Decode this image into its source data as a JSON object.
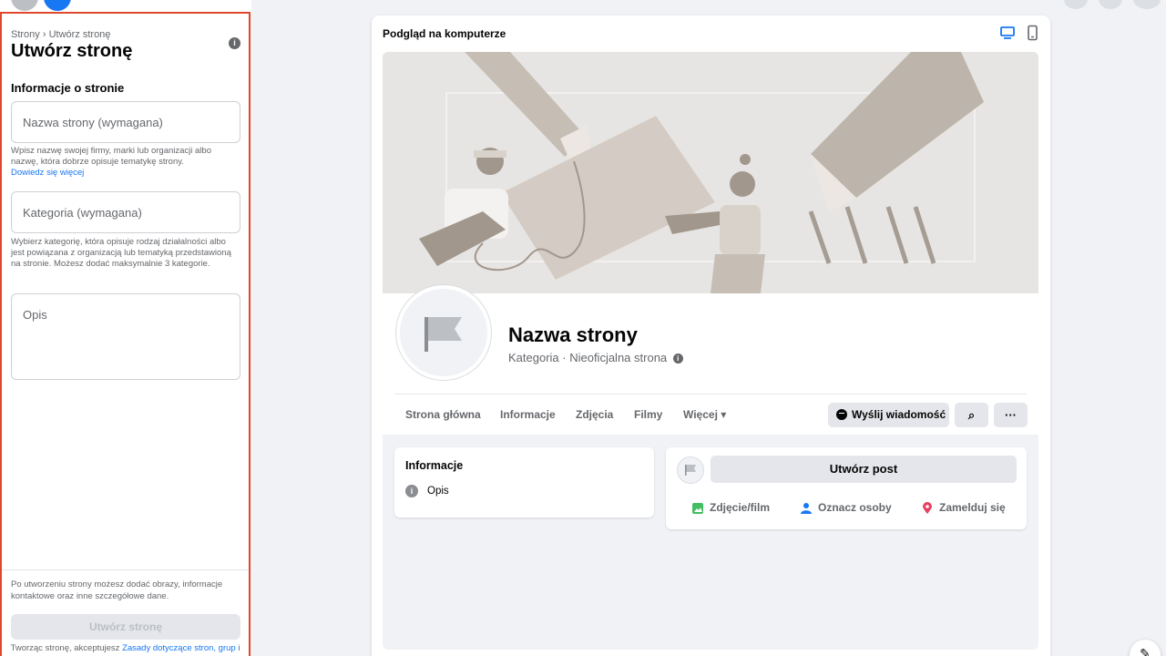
{
  "left_panel": {
    "breadcrumb": "Strony › Utwórz stronę",
    "title": "Utwórz stronę",
    "info_glyph": "i",
    "section_title": "Informacje o stronie",
    "name_field": {
      "placeholder": "Nazwa strony (wymagana)"
    },
    "name_help": "Wpisz nazwę swojej firmy, marki lub organizacji albo nazwę, która dobrze opisuje tematykę strony.",
    "name_help_link": "Dowiedz się więcej",
    "category_field": {
      "placeholder": "Kategoria (wymagana)"
    },
    "category_help": "Wybierz kategorię, która opisuje rodzaj działalności albo jest powiązana z organizacją lub tematyką przedstawioną na stronie. Możesz dodać maksymalnie 3 kategorie.",
    "description_field": {
      "placeholder": "Opis"
    },
    "footer_text": "Po utworzeniu strony możesz dodać obrazy, informacje kontaktowe oraz inne szczegółowe dane.",
    "create_button": "Utwórz stronę",
    "terms_text": "Tworząc stronę, akceptujesz",
    "terms_link": "Zasady dotyczące stron, grup i wydarzeń"
  },
  "preview": {
    "title": "Podgląd na komputerze",
    "icons": [
      "desktop-icon",
      "mobile-icon"
    ],
    "page_name": "Nazwa strony",
    "page_subtitle": "Kategoria · Nieoficjalna strona",
    "info_glyph": "i",
    "tabs": [
      "Strona główna",
      "Informacje",
      "Zdjęcia",
      "Filmy",
      "Więcej ▾"
    ],
    "message_button": "Wyślij wiadomość",
    "search_glyph": "⌕",
    "more_glyph": "···",
    "info_card": {
      "title": "Informacje",
      "row": "Opis"
    },
    "post_card": {
      "button": "Utwórz post",
      "actions": [
        "Zdjęcie/film",
        "Oznacz osoby",
        "Zamelduj się"
      ]
    }
  },
  "colors": {
    "accent": "#1877f2",
    "highlight_border": "#e0472f"
  },
  "edit_glyph": "✎"
}
